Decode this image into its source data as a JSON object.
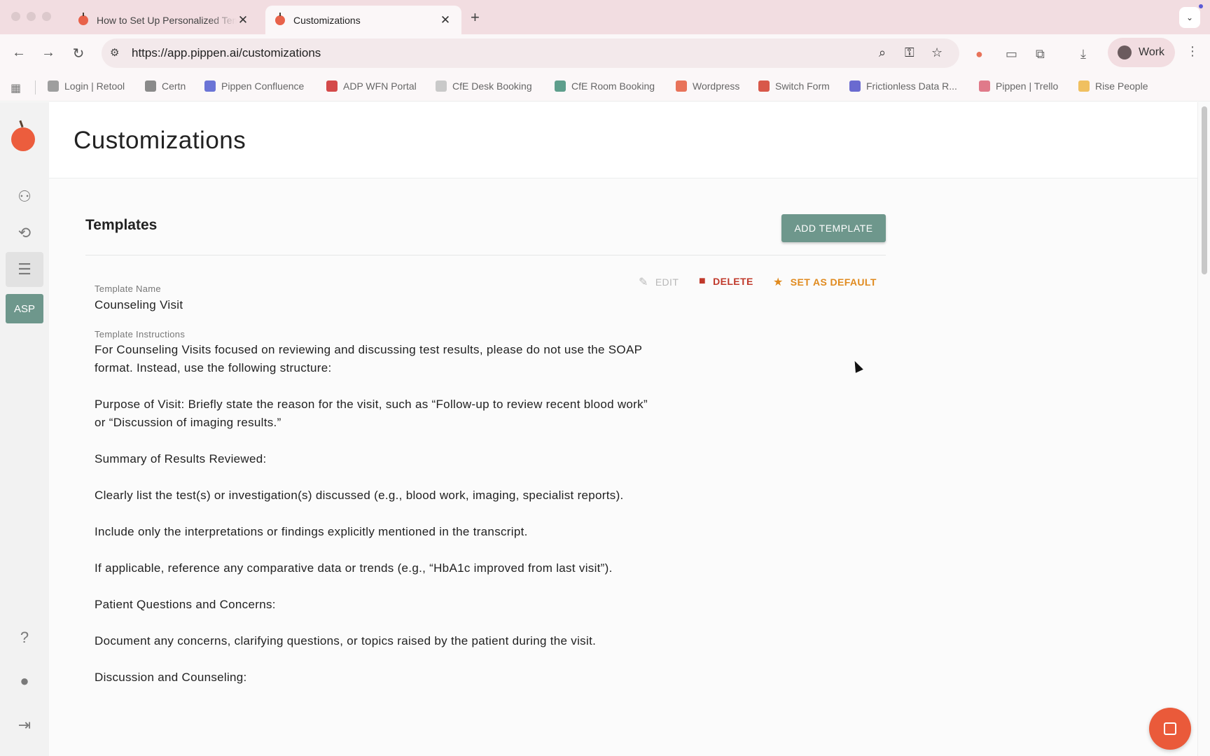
{
  "browser": {
    "tabs": [
      {
        "label": "How to Set Up Personalized Templates",
        "close": "✕"
      },
      {
        "label": "Customizations",
        "close": "✕"
      }
    ],
    "new_tab": "+",
    "tab_menu": "⌄",
    "url": "https://app.pippen.ai/customizations",
    "profile": "Work",
    "bookmarks": [
      {
        "label": "Login | Retool",
        "color": "#9e9e9e"
      },
      {
        "label": "Certn",
        "color": "#8a8a8a"
      },
      {
        "label": "Pippen Confluence",
        "color": "#6b74d6"
      },
      {
        "label": "ADP WFN Portal",
        "color": "#d44a4a"
      },
      {
        "label": "CfE Desk Booking",
        "color": "#c9c9c9"
      },
      {
        "label": "CfE Room Booking",
        "color": "#5e9e8c"
      },
      {
        "label": "Wordpress",
        "color": "#e8735a"
      },
      {
        "label": "Switch Form",
        "color": "#d8584a"
      },
      {
        "label": "Frictionless Data R...",
        "color": "#6a6ad0"
      },
      {
        "label": "Pippen | Trello",
        "color": "#e07a8a"
      },
      {
        "label": "Rise People",
        "color": "#f0c060"
      }
    ]
  },
  "sidebar": {
    "asp_label": "ASP"
  },
  "page": {
    "title": "Customizations",
    "section_title": "Templates",
    "add_button": "ADD TEMPLATE",
    "actions": {
      "edit": "EDIT",
      "delete": "DELETE",
      "set_default": "SET AS DEFAULT"
    },
    "template": {
      "name_label": "Template Name",
      "name_value": "Counseling Visit",
      "instructions_label": "Template Instructions",
      "instructions": [
        "For Counseling Visits focused on reviewing and discussing test results, please do not use the SOAP format. Instead, use the following structure:",
        "Purpose of Visit: Briefly state the reason for the visit, such as “Follow-up to review recent blood work” or “Discussion of imaging results.”",
        "Summary of Results Reviewed:",
        "Clearly list the test(s) or investigation(s) discussed (e.g., blood work, imaging, specialist reports).",
        "Include only the interpretations or findings explicitly mentioned in the transcript.",
        "If applicable, reference any comparative data or trends (e.g., “HbA1c improved from last visit”).",
        "Patient Questions and Concerns:",
        "Document any concerns, clarifying questions, or topics raised by the patient during the visit.",
        "Discussion and Counseling:"
      ]
    }
  },
  "colors": {
    "accent": "#6e978c",
    "brand": "#ec5d3d",
    "delete": "#c0392b",
    "default": "#e08a1e"
  }
}
